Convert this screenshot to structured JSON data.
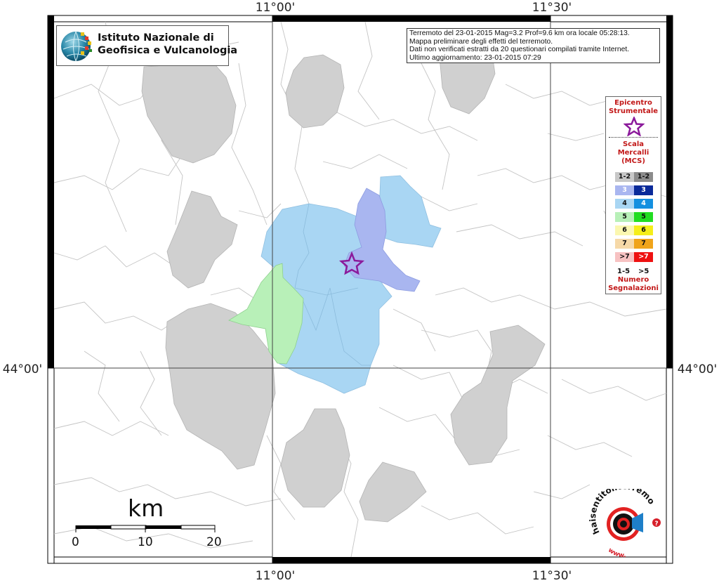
{
  "map": {
    "lon_ticks": [
      "11°00'",
      "11°30'"
    ],
    "lat_ticks": [
      "44°00'"
    ]
  },
  "institute": {
    "line1": "Istituto Nazionale di",
    "line2": "Geofisica e Vulcanologia"
  },
  "info": {
    "line1": "Terremoto del 23-01-2015 Mag=3.2 Prof=9.6 km ora locale 05:28:13.",
    "line2": "Mappa preliminare degli effetti del terremoto.",
    "line3": "Dati non verificati estratti da 20 questionari compilati tramite Internet.",
    "line4": "Ultimo aggiornamento: 23-01-2015 07:29"
  },
  "legend": {
    "epicenter_line1": "Epicentro",
    "epicenter_line2": "Strumentale",
    "scale_line1": "Scala",
    "scale_line2": "Mercalli",
    "scale_line3": "(MCS)",
    "rows": [
      {
        "label": "1-2",
        "light": "#c8c8c8",
        "dark": "#8c8c8c"
      },
      {
        "label": "3",
        "light": "#a9b6f0",
        "dark": "#0a2a9a"
      },
      {
        "label": "4",
        "light": "#a9d6f3",
        "dark": "#1490e0"
      },
      {
        "label": "5",
        "light": "#b8f0b8",
        "dark": "#22dd22"
      },
      {
        "label": "6",
        "light": "#fbf7b0",
        "dark": "#f5ee1a"
      },
      {
        "label": "7",
        "light": "#f6d9a8",
        "dark": "#f0a41a"
      },
      {
        "label": ">7",
        "light": "#f7c2c2",
        "dark": "#ee1111"
      }
    ],
    "count_low": "1-5",
    "count_high": ">5",
    "count_line1": "Numero",
    "count_line2": "Segnalazioni"
  },
  "scalebar": {
    "unit": "km",
    "labels": [
      "0",
      "10",
      "20"
    ]
  },
  "logo": {
    "text": "haisentitoilterremoto.it",
    "www": "www."
  },
  "colors": {
    "intensity3": "#a9b6f0",
    "intensity4": "#a9d6f3",
    "intensity5": "#b8f0b8",
    "not_felt": "#d0d0d0",
    "epicenter": "#8b1a9b"
  }
}
